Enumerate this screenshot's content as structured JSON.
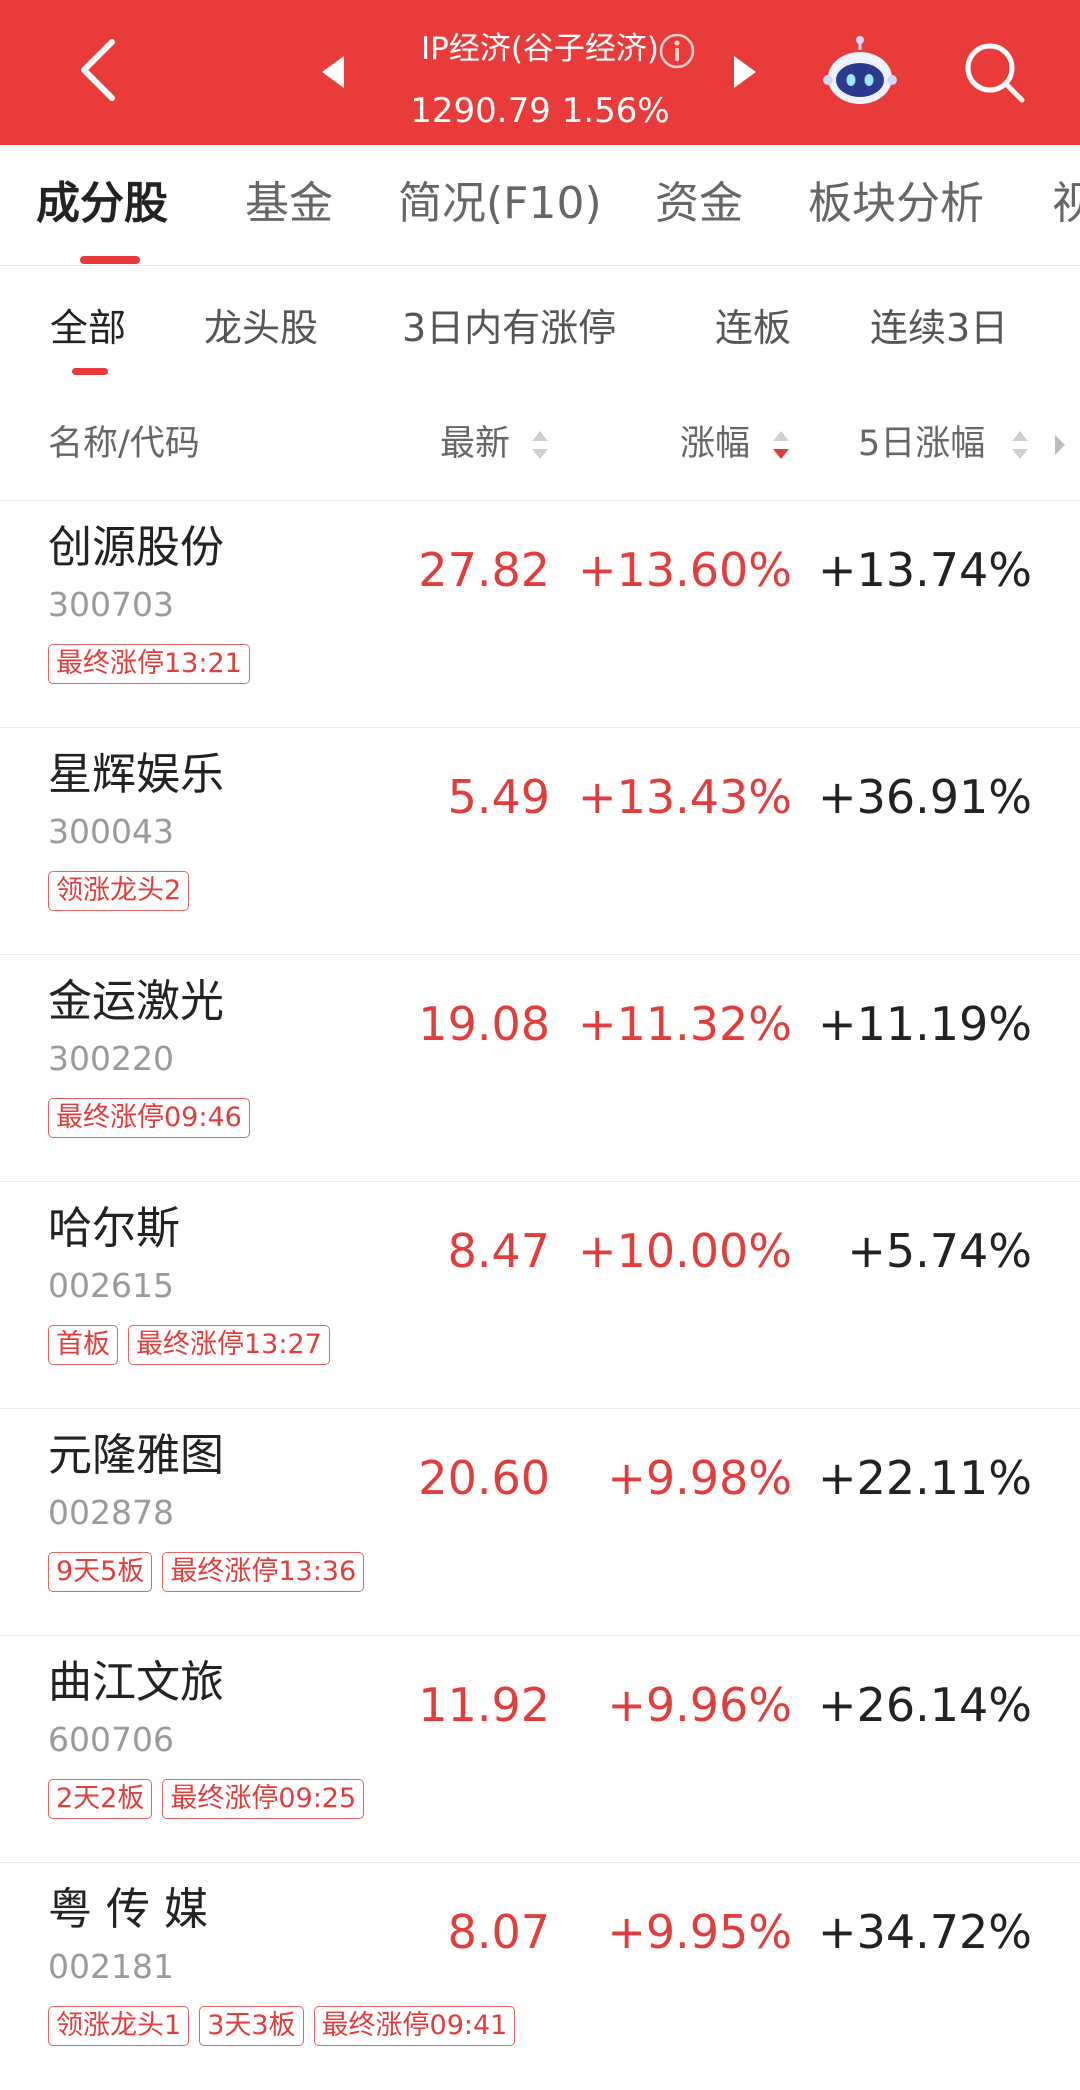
{
  "header": {
    "title": "IP经济(谷子经济)",
    "index_value": "1290.79",
    "index_change": "1.56%",
    "icons": [
      "back-chevron-icon",
      "prev-triangle-icon",
      "info-icon",
      "next-triangle-icon",
      "robot-assistant-icon",
      "search-icon"
    ],
    "colors": {
      "header_bg": "#ea3b3b",
      "rise": "#e23d3d"
    }
  },
  "tabs": [
    {
      "label": "成分股",
      "active": true
    },
    {
      "label": "基金"
    },
    {
      "label": "简况(F10)"
    },
    {
      "label": "资金"
    },
    {
      "label": "板块分析"
    },
    {
      "label": "视"
    }
  ],
  "subtabs": [
    {
      "label": "全部",
      "active": true
    },
    {
      "label": "龙头股"
    },
    {
      "label": "3日内有涨停"
    },
    {
      "label": "连板"
    },
    {
      "label": "连续3日"
    }
  ],
  "columns": {
    "name": "名称/代码",
    "latest": "最新",
    "change": "涨幅",
    "change5d": "5日涨幅",
    "sort_active": "涨幅-descending"
  },
  "rows": [
    {
      "name": "创源股份",
      "code": "300703",
      "latest": "27.82",
      "change": "+13.60%",
      "change5d": "+13.74%",
      "tags": [
        "最终涨停13:21"
      ]
    },
    {
      "name": "星辉娱乐",
      "code": "300043",
      "latest": "5.49",
      "change": "+13.43%",
      "change5d": "+36.91%",
      "tags": [
        "领涨龙头2"
      ]
    },
    {
      "name": "金运激光",
      "code": "300220",
      "latest": "19.08",
      "change": "+11.32%",
      "change5d": "+11.19%",
      "tags": [
        "最终涨停09:46"
      ]
    },
    {
      "name": "哈尔斯",
      "code": "002615",
      "latest": "8.47",
      "change": "+10.00%",
      "change5d": "+5.74%",
      "tags": [
        "首板",
        "最终涨停13:27"
      ]
    },
    {
      "name": "元隆雅图",
      "code": "002878",
      "latest": "20.60",
      "change": "+9.98%",
      "change5d": "+22.11%",
      "tags": [
        "9天5板",
        "最终涨停13:36"
      ]
    },
    {
      "name": "曲江文旅",
      "code": "600706",
      "latest": "11.92",
      "change": "+9.96%",
      "change5d": "+26.14%",
      "tags": [
        "2天2板",
        "最终涨停09:25"
      ]
    },
    {
      "name": "粤 传 媒",
      "code": "002181",
      "latest": "8.07",
      "change": "+9.95%",
      "change5d": "+34.72%",
      "tags": [
        "领涨龙头1",
        "3天3板",
        "最终涨停09:41"
      ]
    }
  ]
}
